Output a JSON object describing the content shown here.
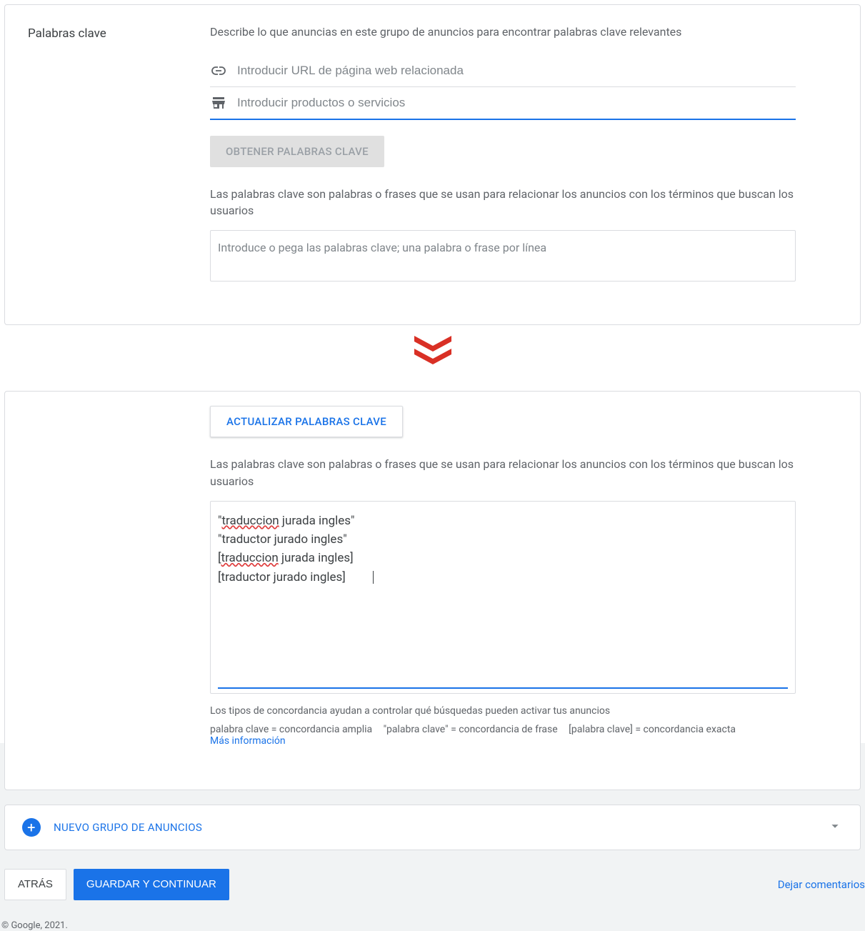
{
  "sidebar_label": "Palabras clave",
  "top": {
    "description": "Describe lo que anuncias en este grupo de anuncios para encontrar palabras clave relevantes",
    "url_placeholder": "Introducir URL de página web relacionada",
    "products_placeholder": "Introducir productos o servicios",
    "get_kw_button": "OBTENER PALABRAS CLAVE",
    "help": "Las palabras clave son palabras o frases que se usan para relacionar los anuncios con los términos que buscan los usuarios",
    "kw_placeholder": "Introduce o pega las palabras clave; una palabra o frase por línea"
  },
  "bottom": {
    "update_button": "ACTUALIZAR PALABRAS CLAVE",
    "help": "Las palabras clave son palabras o frases que se usan para relacionar los anuncios con los términos que buscan los usuarios",
    "keywords_lines": [
      {
        "prefix": "\"",
        "spelled": "traduccion",
        "rest": " jurada ingles\""
      },
      {
        "prefix": "\"",
        "spelled": "",
        "rest": "traductor jurado ingles\""
      },
      {
        "prefix": "[",
        "spelled": "traduccion",
        "rest": " jurada ingles]"
      },
      {
        "prefix": "[",
        "spelled": "",
        "rest": "traductor jurado ingles]"
      }
    ],
    "match_info": "Los tipos de concordancia ayudan a controlar qué búsquedas pueden activar tus anuncios",
    "legend_broad": "palabra clave = concordancia amplia",
    "legend_phrase": "\"palabra clave\" = concordancia de frase",
    "legend_exact": "[palabra clave] = concordancia exacta",
    "learn_more": "Más información"
  },
  "add_group": {
    "label": "NUEVO GRUPO DE ANUNCIOS"
  },
  "footer": {
    "back": "ATRÁS",
    "save": "GUARDAR Y CONTINUAR",
    "feedback": "Dejar comentarios",
    "copyright": "© Google, 2021."
  }
}
